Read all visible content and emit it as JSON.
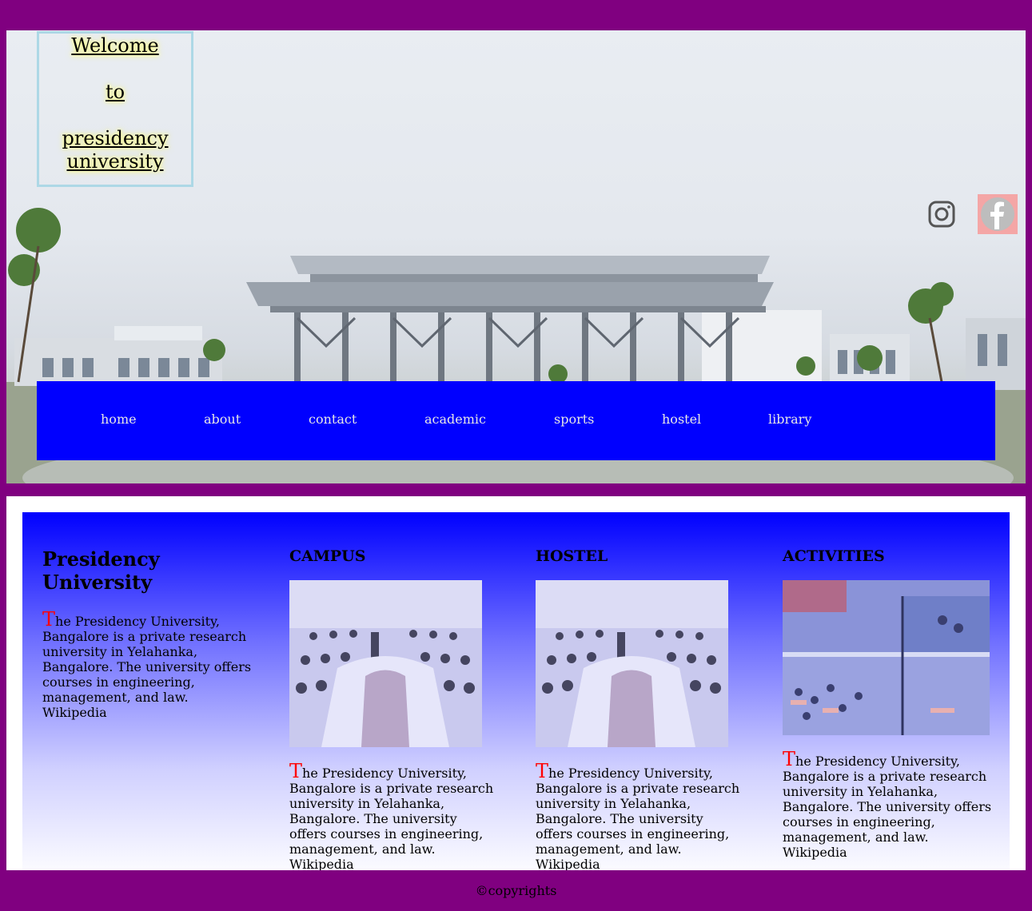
{
  "welcome": {
    "line1": "Welcome",
    "line2": "to",
    "line3": "presidency university"
  },
  "social": {
    "instagram_icon": "instagram-icon",
    "facebook_icon": "facebook-icon"
  },
  "nav": {
    "items": [
      "home",
      "about",
      "contact",
      "academic",
      "sports",
      "hostel",
      "library"
    ]
  },
  "intro": {
    "title": "Presidency University",
    "cap": "T",
    "text": "he Presidency University, Bangalore is a private research university in Yelahanka, Bangalore. The university offers courses in engineering, management, and law. Wikipedia"
  },
  "sections": [
    {
      "heading": "CAMPUS",
      "cap": "T",
      "text": "he Presidency University, Bangalore is a private research university in Yelahanka, Bangalore. The university offers courses in engineering, management, and law. Wikipedia"
    },
    {
      "heading": "HOSTEL",
      "cap": "T",
      "text": "he Presidency University, Bangalore is a private research university in Yelahanka, Bangalore. The university offers courses in engineering, management, and law. Wikipedia"
    },
    {
      "heading": "ACTIVITIES",
      "cap": "T",
      "text": "he Presidency University, Bangalore is a private research university in Yelahanka, Bangalore. The university offers courses in engineering, management, and law. Wikipedia"
    }
  ],
  "footer": {
    "text": "©copyrights"
  },
  "colors": {
    "page_bg": "#800080",
    "nav_bg": "#0000ff",
    "nav_text": "#e6e6e6",
    "dropcap": "#ff0000"
  }
}
